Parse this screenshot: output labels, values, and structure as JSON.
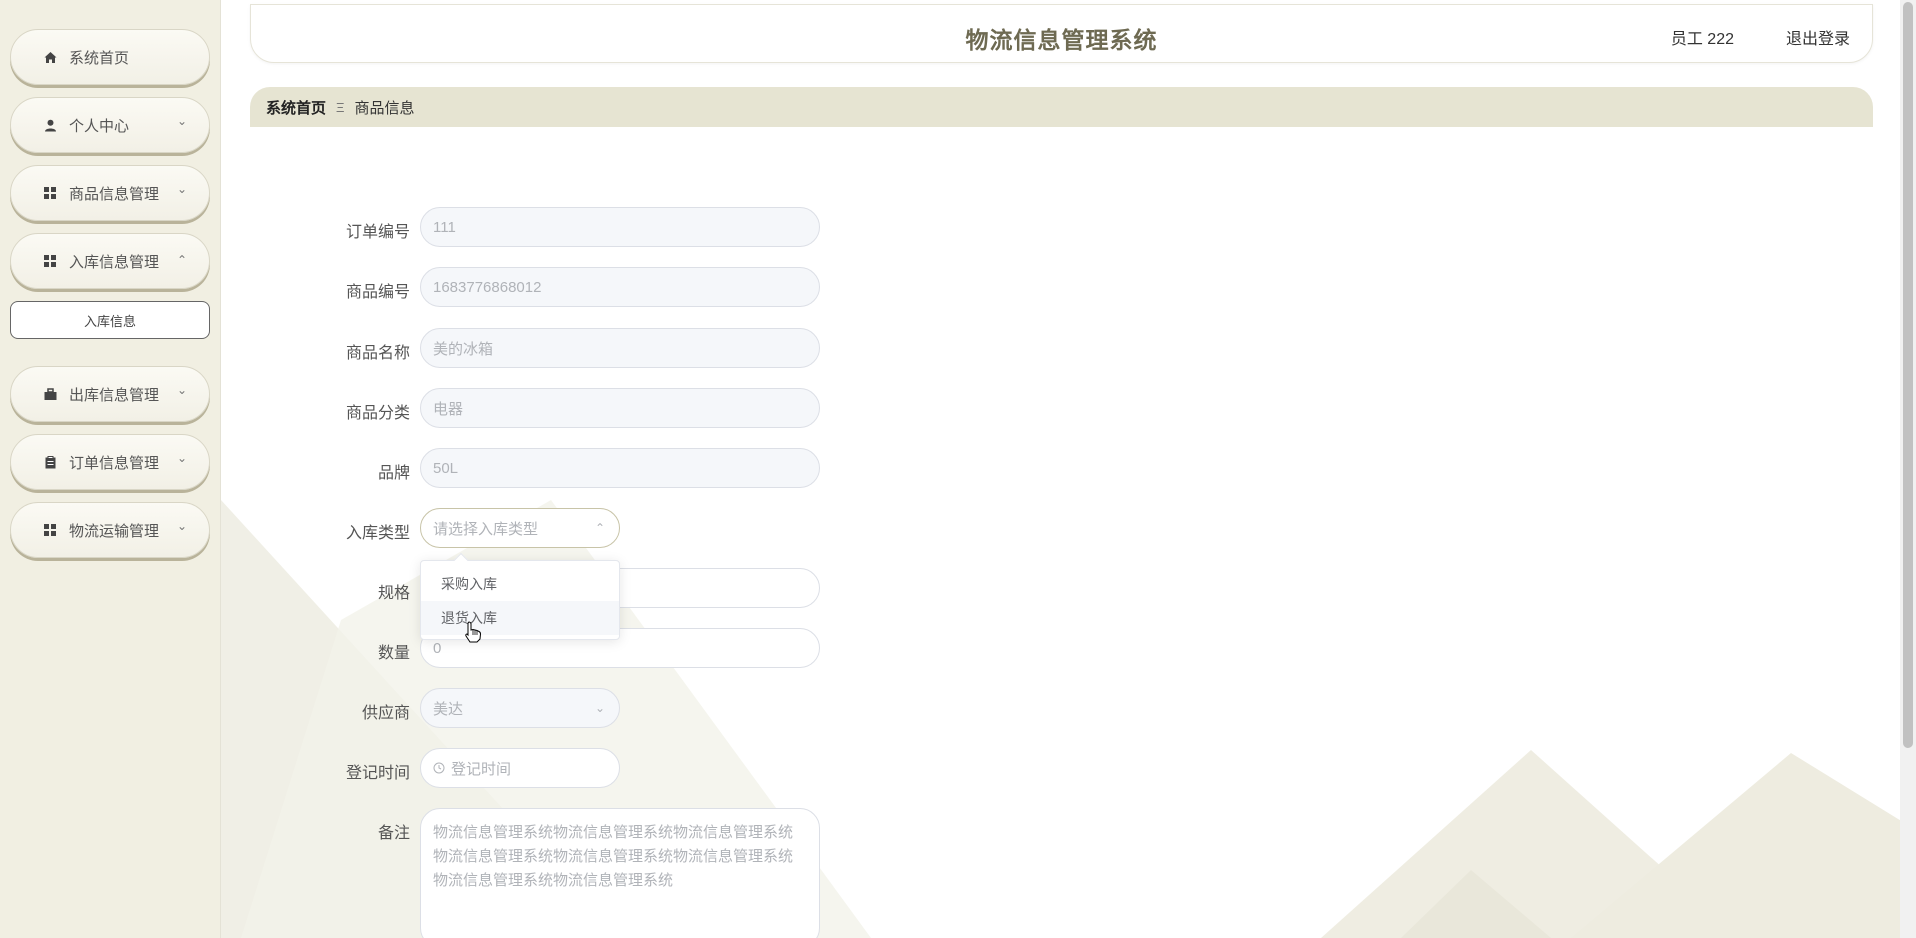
{
  "sidebar": {
    "items": [
      {
        "label": "系统首页",
        "icon": "home-icon"
      },
      {
        "label": "个人中心",
        "icon": "user-icon"
      },
      {
        "label": "商品信息管理",
        "icon": "grid-icon"
      },
      {
        "label": "入库信息管理",
        "icon": "grid-icon"
      },
      {
        "label": "出库信息管理",
        "icon": "briefcase-icon"
      },
      {
        "label": "订单信息管理",
        "icon": "clipboard-icon"
      },
      {
        "label": "物流运输管理",
        "icon": "grid-icon"
      }
    ],
    "sub_item": "入库信息"
  },
  "header": {
    "title": "物流信息管理系统",
    "user": "员工 222",
    "logout": "退出登录"
  },
  "breadcrumb": {
    "home": "系统首页",
    "separator": "Ξ",
    "current": "商品信息"
  },
  "form": {
    "order_no": {
      "label": "订单编号",
      "value": "111"
    },
    "product_no": {
      "label": "商品编号",
      "value": "1683776868012"
    },
    "product_name": {
      "label": "商品名称",
      "value": "美的冰箱"
    },
    "category": {
      "label": "商品分类",
      "value": "电器"
    },
    "brand": {
      "label": "品牌",
      "value": "50L"
    },
    "inbound_type": {
      "label": "入库类型",
      "placeholder": "请选择入库类型"
    },
    "spec": {
      "label": "规格",
      "value": ""
    },
    "quantity": {
      "label": "数量",
      "value": "0"
    },
    "supplier": {
      "label": "供应商",
      "value": "美达"
    },
    "reg_time": {
      "label": "登记时间",
      "placeholder": "登记时间"
    },
    "remark": {
      "label": "备注",
      "value": "物流信息管理系统物流信息管理系统物流信息管理系统物流信息管理系统物流信息管理系统物流信息管理系统物流信息管理系统物流信息管理系统"
    }
  },
  "dropdown": {
    "options": [
      "采购入库",
      "退货入库"
    ],
    "hovered_index": 1
  },
  "colors": {
    "sidebar_bg": "#f1efe2",
    "breadcrumb_bg": "#e6e4d2",
    "title_color": "#6e6a52"
  }
}
